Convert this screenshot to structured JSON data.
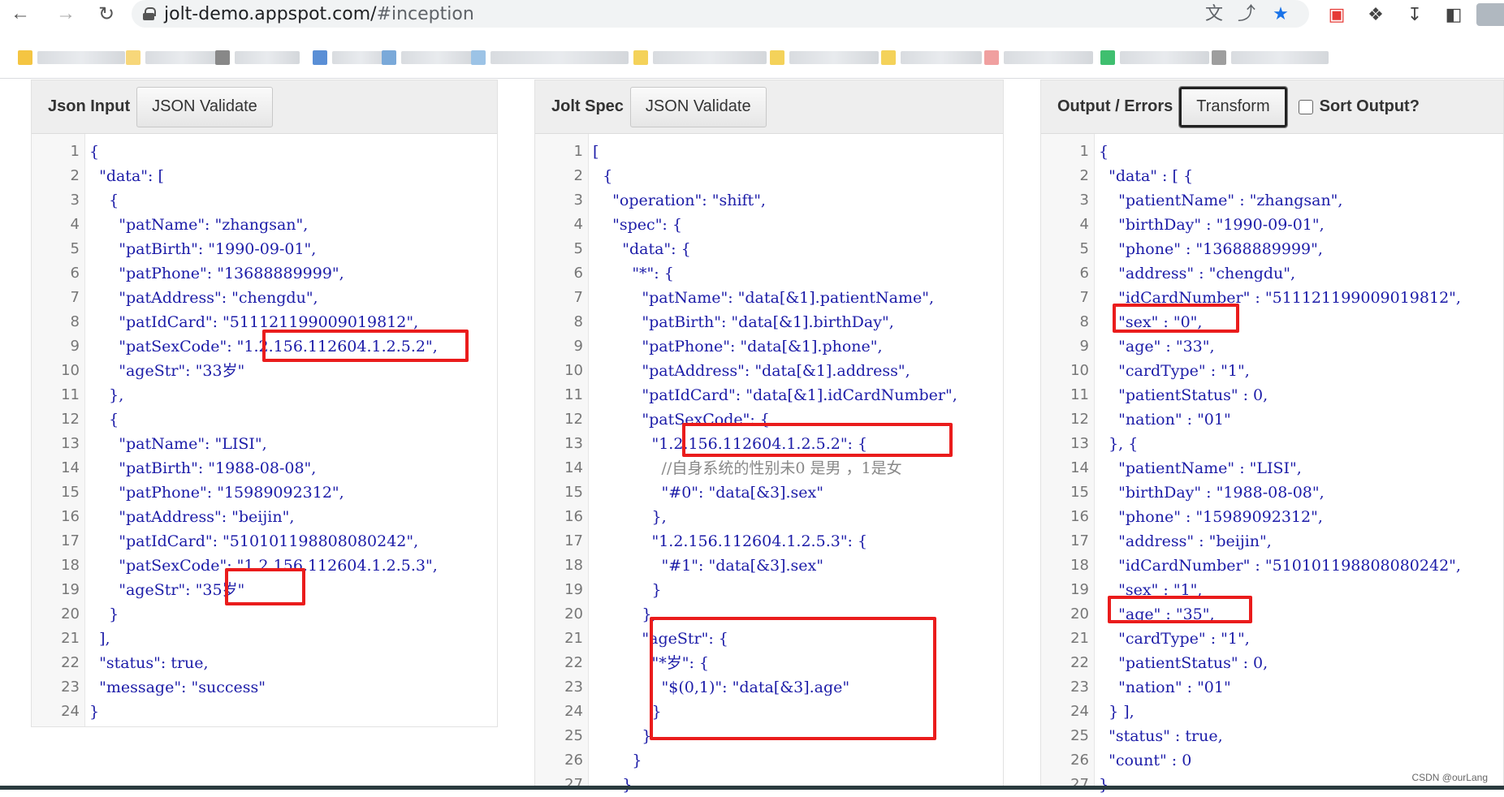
{
  "browser": {
    "url_host": "jolt-demo.appspot.com/",
    "url_hash": "#inception"
  },
  "panels": {
    "input": {
      "title": "Json Input",
      "validate_label": "JSON Validate",
      "lines": [
        "{",
        "  \"data\": [",
        "    {",
        "      \"patName\": \"zhangsan\",",
        "      \"patBirth\": \"1990-09-01\",",
        "      \"patPhone\": \"13688889999\",",
        "      \"patAddress\": \"chengdu\",",
        "      \"patIdCard\": \"511121199009019812\",",
        "      \"patSexCode\": \"1.2.156.112604.1.2.5.2\",",
        "      \"ageStr\": \"33岁\"",
        "    },",
        "    {",
        "      \"patName\": \"LISI\",",
        "      \"patBirth\": \"1988-08-08\",",
        "      \"patPhone\": \"15989092312\",",
        "      \"patAddress\": \"beijin\",",
        "      \"patIdCard\": \"510101198808080242\",",
        "      \"patSexCode\": \"1.2.156.112604.1.2.5.3\",",
        "      \"ageStr\": \"35岁\"",
        "    }",
        "  ],",
        "  \"status\": true,",
        "  \"message\": \"success\"",
        "}"
      ]
    },
    "spec": {
      "title": "Jolt Spec",
      "validate_label": "JSON Validate",
      "lines": [
        "[",
        "  {",
        "    \"operation\": \"shift\",",
        "    \"spec\": {",
        "      \"data\": {",
        "        \"*\": {",
        "          \"patName\": \"data[&1].patientName\",",
        "          \"patBirth\": \"data[&1].birthDay\",",
        "          \"patPhone\": \"data[&1].phone\",",
        "          \"patAddress\": \"data[&1].address\",",
        "          \"patIdCard\": \"data[&1].idCardNumber\",",
        "          \"patSexCode\": {",
        "            \"1.2.156.112604.1.2.5.2\": {",
        "              //自身系统的性别未0 是男 ，1是女",
        "              \"#0\": \"data[&3].sex\"",
        "            },",
        "            \"1.2.156.112604.1.2.5.3\": {",
        "              \"#1\": \"data[&3].sex\"",
        "            }",
        "          },",
        "          \"ageStr\": {",
        "            \"*岁\": {",
        "              \"$(0,1)\": \"data[&3].age\"",
        "            }",
        "          }",
        "        }",
        "      }"
      ]
    },
    "output": {
      "title": "Output / Errors",
      "transform_label": "Transform",
      "sort_label": "Sort Output?",
      "lines": [
        "{",
        "  \"data\" : [ {",
        "    \"patientName\" : \"zhangsan\",",
        "    \"birthDay\" : \"1990-09-01\",",
        "    \"phone\" : \"13688889999\",",
        "    \"address\" : \"chengdu\",",
        "    \"idCardNumber\" : \"511121199009019812\",",
        "    \"sex\" : \"0\",",
        "    \"age\" : \"33\",",
        "    \"cardType\" : \"1\",",
        "    \"patientStatus\" : 0,",
        "    \"nation\" : \"01\"",
        "  }, {",
        "    \"patientName\" : \"LISI\",",
        "    \"birthDay\" : \"1988-08-08\",",
        "    \"phone\" : \"15989092312\",",
        "    \"address\" : \"beijin\",",
        "    \"idCardNumber\" : \"510101198808080242\",",
        "    \"sex\" : \"1\",",
        "    \"age\" : \"35\",",
        "    \"cardType\" : \"1\",",
        "    \"patientStatus\" : 0,",
        "    \"nation\" : \"01\"",
        "  } ],",
        "  \"status\" : true,",
        "  \"count\" : 0",
        "}"
      ]
    }
  },
  "watermark": "CSDN @ourLang",
  "colors": {
    "highlight": "#ea1c1c",
    "code": "#1c1ca8"
  }
}
